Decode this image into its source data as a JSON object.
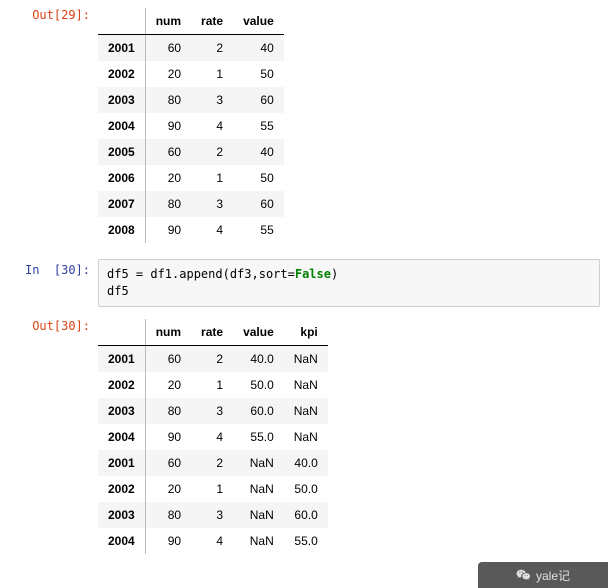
{
  "cells": {
    "out29": {
      "prompt": "Out[29]:",
      "table": {
        "columns": [
          "num",
          "rate",
          "value"
        ],
        "rows": [
          {
            "index": "2001",
            "values": [
              "60",
              "2",
              "40"
            ]
          },
          {
            "index": "2002",
            "values": [
              "20",
              "1",
              "50"
            ]
          },
          {
            "index": "2003",
            "values": [
              "80",
              "3",
              "60"
            ]
          },
          {
            "index": "2004",
            "values": [
              "90",
              "4",
              "55"
            ]
          },
          {
            "index": "2005",
            "values": [
              "60",
              "2",
              "40"
            ]
          },
          {
            "index": "2006",
            "values": [
              "20",
              "1",
              "50"
            ]
          },
          {
            "index": "2007",
            "values": [
              "80",
              "3",
              "60"
            ]
          },
          {
            "index": "2008",
            "values": [
              "90",
              "4",
              "55"
            ]
          }
        ]
      }
    },
    "in30": {
      "prompt": "In  [30]:",
      "code_prefix": "df5 = df1.append(df3,sort=",
      "code_keyword": "False",
      "code_suffix_line1": ")",
      "code_line2": "df5"
    },
    "out30": {
      "prompt": "Out[30]:",
      "table": {
        "columns": [
          "num",
          "rate",
          "value",
          "kpi"
        ],
        "rows": [
          {
            "index": "2001",
            "values": [
              "60",
              "2",
              "40.0",
              "NaN"
            ]
          },
          {
            "index": "2002",
            "values": [
              "20",
              "1",
              "50.0",
              "NaN"
            ]
          },
          {
            "index": "2003",
            "values": [
              "80",
              "3",
              "60.0",
              "NaN"
            ]
          },
          {
            "index": "2004",
            "values": [
              "90",
              "4",
              "55.0",
              "NaN"
            ]
          },
          {
            "index": "2001",
            "values": [
              "60",
              "2",
              "NaN",
              "40.0"
            ]
          },
          {
            "index": "2002",
            "values": [
              "20",
              "1",
              "NaN",
              "50.0"
            ]
          },
          {
            "index": "2003",
            "values": [
              "80",
              "3",
              "NaN",
              "60.0"
            ]
          },
          {
            "index": "2004",
            "values": [
              "90",
              "4",
              "NaN",
              "55.0"
            ]
          }
        ]
      }
    }
  },
  "watermark": "yale记"
}
